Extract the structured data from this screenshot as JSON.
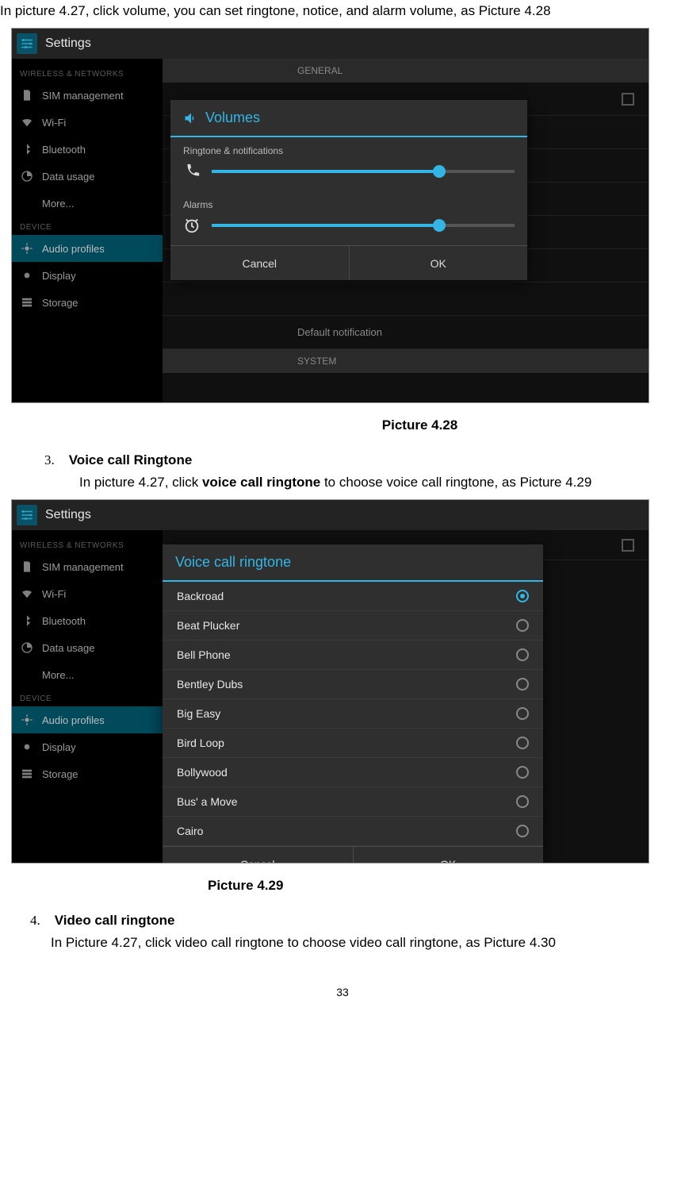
{
  "doc": {
    "intro": "In picture 4.27, click volume, you can set ringtone, notice, and alarm volume, as Picture 4.28",
    "caption428": "Picture 4.28",
    "item3_num": "3.",
    "item3_title": "Voice call Ringtone",
    "item3_body_a": "In picture 4.27, click ",
    "item3_body_b": "voice call ringtone",
    "item3_body_c": " to choose voice call ringtone, as Picture 4.29",
    "caption429": "Picture 4.29",
    "item4_num": "4.",
    "item4_title": "Video call ringtone",
    "item4_body": "In Picture 4.27, click video call ringtone to choose video call ringtone, as Picture 4.30",
    "page_num": "33"
  },
  "ui": {
    "settings_title": "Settings",
    "sb_header_wn": "WIRELESS & NETWORKS",
    "sb_header_dev": "DEVICE",
    "sb_sim": "SIM management",
    "sb_wifi": "Wi-Fi",
    "sb_bt": "Bluetooth",
    "sb_data": "Data usage",
    "sb_more": "More...",
    "sb_audio": "Audio profiles",
    "sb_display": "Display",
    "sb_storage": "Storage",
    "mp_general": "GENERAL",
    "mp_defnot": "Default notification",
    "mp_system": "SYSTEM",
    "vol_title": "Volumes",
    "vol_label1": "Ringtone & notifications",
    "vol_label2": "Alarms",
    "btn_cancel": "Cancel",
    "btn_ok": "OK",
    "ring_title": "Voice call ringtone",
    "ringtones": [
      "Backroad",
      "Beat Plucker",
      "Bell Phone",
      "Bentley Dubs",
      "Big Easy",
      "Bird Loop",
      "Bollywood",
      "Bus' a Move",
      "Cairo"
    ],
    "selected_ringtone_index": 0,
    "slider1_pct": 75,
    "slider2_pct": 75
  }
}
